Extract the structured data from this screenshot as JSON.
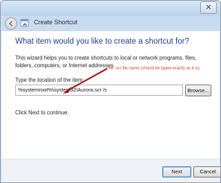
{
  "window": {
    "title": "Create Shortcut",
    "close_glyph": "✕"
  },
  "main": {
    "heading": "What item would you like to create a shortcut for?",
    "description": "This wizard helps you to create shortcuts to local or network programs, files, folders, computers, or Internet addresses.",
    "annotation": "the .scr file name (should be typed exactly as it is).",
    "field_label": "Type the location of the item:",
    "location_value": "%systemroot%\\system32\\Aurora.scr /s",
    "browse_label": "Browse...",
    "next_hint": "Click Next to continue."
  },
  "footer": {
    "next_label": "Next",
    "cancel_label": "Cancel"
  },
  "colors": {
    "heading": "#1f3e8f",
    "annotation": "#c8452a",
    "arrow": "#a01a1a"
  },
  "icons": [
    "back-arrow-icon",
    "shortcut-wizard-icon",
    "close-icon"
  ]
}
